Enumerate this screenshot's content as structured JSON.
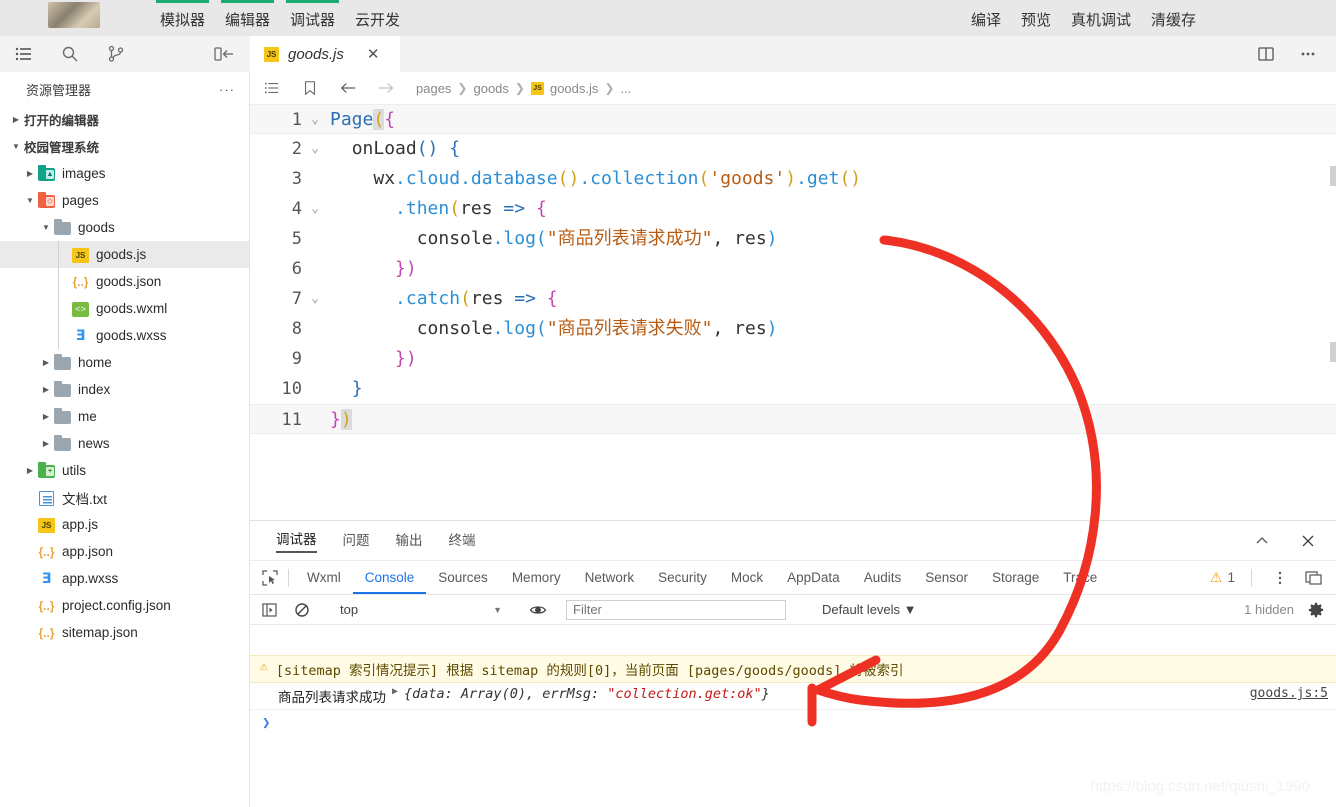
{
  "topbar": {
    "items": [
      {
        "label": "模拟器",
        "active": true
      },
      {
        "label": "编辑器",
        "active": true
      },
      {
        "label": "调试器",
        "active": true
      },
      {
        "label": "云开发",
        "active": false
      }
    ],
    "right_items": [
      {
        "label": "编译"
      },
      {
        "label": "预览"
      },
      {
        "label": "真机调试"
      },
      {
        "label": "清缓存"
      }
    ],
    "accent_color": "#1aad6e"
  },
  "activity_bar": {
    "icons": [
      "explorer-icon",
      "search-icon",
      "source-control-icon",
      "collapse-sidebar-icon"
    ]
  },
  "tabstrip": {
    "tab": {
      "label": "goods.js",
      "badge": "JS",
      "close": "✕"
    },
    "right_icons": [
      "split-editor-icon",
      "more-actions-icon"
    ]
  },
  "sidebar": {
    "title": "资源管理器",
    "more": "···",
    "sections": [
      {
        "label": "打开的编辑器",
        "expanded": false
      },
      {
        "label": "校园管理系统",
        "expanded": true
      }
    ],
    "tree": [
      {
        "label": "images",
        "icon": "folder-images-icon",
        "depth": 1,
        "twisty": "collapsed",
        "selected": false
      },
      {
        "label": "pages",
        "icon": "folder-pages-icon",
        "depth": 1,
        "twisty": "expanded",
        "selected": false
      },
      {
        "label": "goods",
        "icon": "folder-icon",
        "depth": 2,
        "twisty": "expanded",
        "selected": false
      },
      {
        "label": "goods.js",
        "icon": "js-icon",
        "depth": 3,
        "twisty": "none",
        "selected": true
      },
      {
        "label": "goods.json",
        "icon": "json-icon",
        "depth": 3,
        "twisty": "none",
        "selected": false
      },
      {
        "label": "goods.wxml",
        "icon": "wxml-icon",
        "depth": 3,
        "twisty": "none",
        "selected": false
      },
      {
        "label": "goods.wxss",
        "icon": "wxss-icon",
        "depth": 3,
        "twisty": "none",
        "selected": false
      },
      {
        "label": "home",
        "icon": "folder-icon",
        "depth": 2,
        "twisty": "collapsed",
        "selected": false
      },
      {
        "label": "index",
        "icon": "folder-icon",
        "depth": 2,
        "twisty": "collapsed",
        "selected": false
      },
      {
        "label": "me",
        "icon": "folder-icon",
        "depth": 2,
        "twisty": "collapsed",
        "selected": false
      },
      {
        "label": "news",
        "icon": "folder-icon",
        "depth": 2,
        "twisty": "collapsed",
        "selected": false
      },
      {
        "label": "utils",
        "icon": "folder-utils-icon",
        "depth": 1,
        "twisty": "collapsed",
        "selected": false
      },
      {
        "label": "文档.txt",
        "icon": "txt-icon",
        "depth": 1,
        "twisty": "none",
        "selected": false
      },
      {
        "label": "app.js",
        "icon": "js-icon",
        "depth": 1,
        "twisty": "none",
        "selected": false
      },
      {
        "label": "app.json",
        "icon": "json-icon",
        "depth": 1,
        "twisty": "none",
        "selected": false
      },
      {
        "label": "app.wxss",
        "icon": "wxss-icon",
        "depth": 1,
        "twisty": "none",
        "selected": false
      },
      {
        "label": "project.config.json",
        "icon": "json-icon",
        "depth": 1,
        "twisty": "none",
        "selected": false
      },
      {
        "label": "sitemap.json",
        "icon": "json-icon",
        "depth": 1,
        "twisty": "none",
        "selected": false
      }
    ]
  },
  "editor": {
    "breadcrumb": [
      "pages",
      "goods",
      "goods.js",
      "..."
    ],
    "breadcrumb_badge": "JS",
    "nav_icons": [
      "outline-icon",
      "bookmark-icon",
      "back-icon",
      "forward-icon"
    ],
    "lines": [
      {
        "n": "1",
        "fold": "⌄"
      },
      {
        "n": "2",
        "fold": "⌄"
      },
      {
        "n": "3",
        "fold": ""
      },
      {
        "n": "4",
        "fold": "⌄"
      },
      {
        "n": "5",
        "fold": ""
      },
      {
        "n": "6",
        "fold": ""
      },
      {
        "n": "7",
        "fold": "⌄"
      },
      {
        "n": "8",
        "fold": ""
      },
      {
        "n": "9",
        "fold": ""
      },
      {
        "n": "10",
        "fold": ""
      },
      {
        "n": "11",
        "fold": ""
      }
    ],
    "code": {
      "l1_page": "Page",
      "l1_paren": "(",
      "l1_brace": "{",
      "l2_fn": "onLoad",
      "l2_paren": "()",
      "l2_brace": " {",
      "l3_wx": "wx",
      "l3_cloud": ".cloud",
      "l3_database": ".database",
      "l3_p1": "()",
      "l3_collection": ".collection",
      "l3_p2o": "(",
      "l3_str": "'goods'",
      "l3_p2c": ")",
      "l3_get": ".get",
      "l3_p3": "()",
      "l4_then": ".then",
      "l4_po": "(",
      "l4_res": "res ",
      "l4_arrow": "=>",
      "l4_brace": " {",
      "l5_console": "console",
      "l5_log": ".log",
      "l5_po": "(",
      "l5_str": "\"商品列表请求成功\"",
      "l5_comma": ", ",
      "l5_res": "res",
      "l5_pc": ")",
      "l6_close": "})",
      "l7_catch": ".catch",
      "l7_po": "(",
      "l7_res": "res ",
      "l7_arrow": "=>",
      "l7_brace": " {",
      "l8_console": "console",
      "l8_log": ".log",
      "l8_po": "(",
      "l8_str": "\"商品列表请求失败\"",
      "l8_comma": ", ",
      "l8_res": "res",
      "l8_pc": ")",
      "l9_close": "})",
      "l10_close": "}",
      "l11_brace": "}",
      "l11_paren": ")"
    }
  },
  "devtools": {
    "outer_tabs": [
      {
        "label": "调试器",
        "active": true
      },
      {
        "label": "问题",
        "active": false
      },
      {
        "label": "输出",
        "active": false
      },
      {
        "label": "终端",
        "active": false
      }
    ],
    "outer_right_icons": [
      "chevron-up-icon",
      "close-icon"
    ],
    "panels": [
      {
        "label": "Wxml",
        "active": false
      },
      {
        "label": "Console",
        "active": true
      },
      {
        "label": "Sources",
        "active": false
      },
      {
        "label": "Memory",
        "active": false
      },
      {
        "label": "Network",
        "active": false
      },
      {
        "label": "Security",
        "active": false
      },
      {
        "label": "Mock",
        "active": false
      },
      {
        "label": "AppData",
        "active": false
      },
      {
        "label": "Audits",
        "active": false
      },
      {
        "label": "Sensor",
        "active": false
      },
      {
        "label": "Storage",
        "active": false
      },
      {
        "label": "Trace",
        "active": false
      }
    ],
    "inspect_icon": "inspect-element-icon",
    "warning_count": "1",
    "warning_icon": "warning-triangle-icon",
    "more_icon": "more-vertical-icon",
    "dock_icon": "dock-side-icon",
    "filterbar": {
      "sidebar_icon": "console-sidebar-icon",
      "clear_icon": "clear-console-icon",
      "context": "top",
      "caret": "▼",
      "eye_icon": "live-expression-icon",
      "filter_placeholder": "Filter",
      "levels_label": "Default levels",
      "levels_caret": "▼",
      "hidden_label": "1 hidden",
      "settings_icon": "settings-gear-icon"
    },
    "messages": [
      {
        "type": "warn",
        "icon": "warning-triangle-icon",
        "text": "[sitemap 索引情况提示] 根据 sitemap 的规则[0]，当前页面 [pages/goods/goods] 将被索引",
        "source": ""
      },
      {
        "type": "log",
        "text": "商品列表请求成功",
        "expand_arrow": "▶",
        "object_prefix": "{data: Array(0), errMsg: ",
        "object_string": "\"collection.get:ok\"",
        "object_suffix": "}",
        "source": "goods.js:5"
      }
    ],
    "prompt": "❯"
  },
  "watermark": "https://blog.csdn.net/qiushi_1990",
  "annotation": {
    "color": "#ee3124",
    "description": "red-hand-drawn-arrow"
  }
}
